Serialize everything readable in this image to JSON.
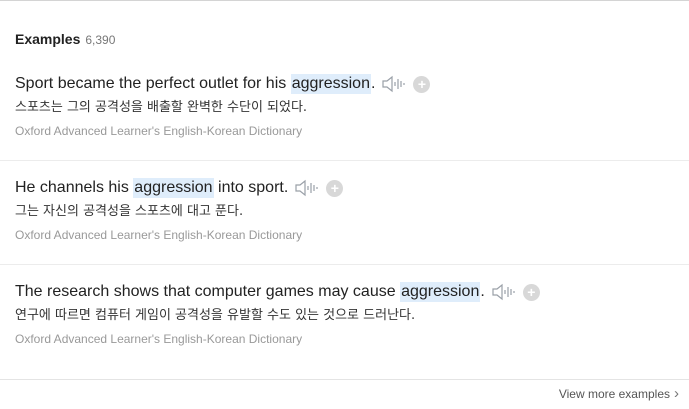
{
  "header": {
    "title": "Examples",
    "count": "6,390"
  },
  "examples": [
    {
      "before": "Sport became the perfect outlet for his ",
      "highlight": "aggression",
      "after": ".",
      "translation": "스포츠는 그의 공격성을 배출할 완벽한 수단이 되었다.",
      "source": "Oxford Advanced Learner's English-Korean Dictionary"
    },
    {
      "before": "He channels his ",
      "highlight": "aggression",
      "after": " into sport.",
      "translation": "그는 자신의 공격성을 스포츠에 대고 푼다.",
      "source": "Oxford Advanced Learner's English-Korean Dictionary"
    },
    {
      "before": "The research shows that computer games may cause ",
      "highlight": "aggression",
      "after": ".",
      "translation": "연구에 따르면 컴퓨터 게임이 공격성을 유발할 수도 있는 것으로 드러난다.",
      "source": "Oxford Advanced Learner's English-Korean Dictionary"
    }
  ],
  "footer": {
    "view_more_label": "View more examples",
    "chevron": "›"
  },
  "icons": {
    "speaker": "speaker-icon",
    "add": "plus-circle-icon"
  },
  "colors": {
    "highlight": "#dfedfb",
    "icon": "#9aa0a8",
    "source_text": "#999999"
  }
}
